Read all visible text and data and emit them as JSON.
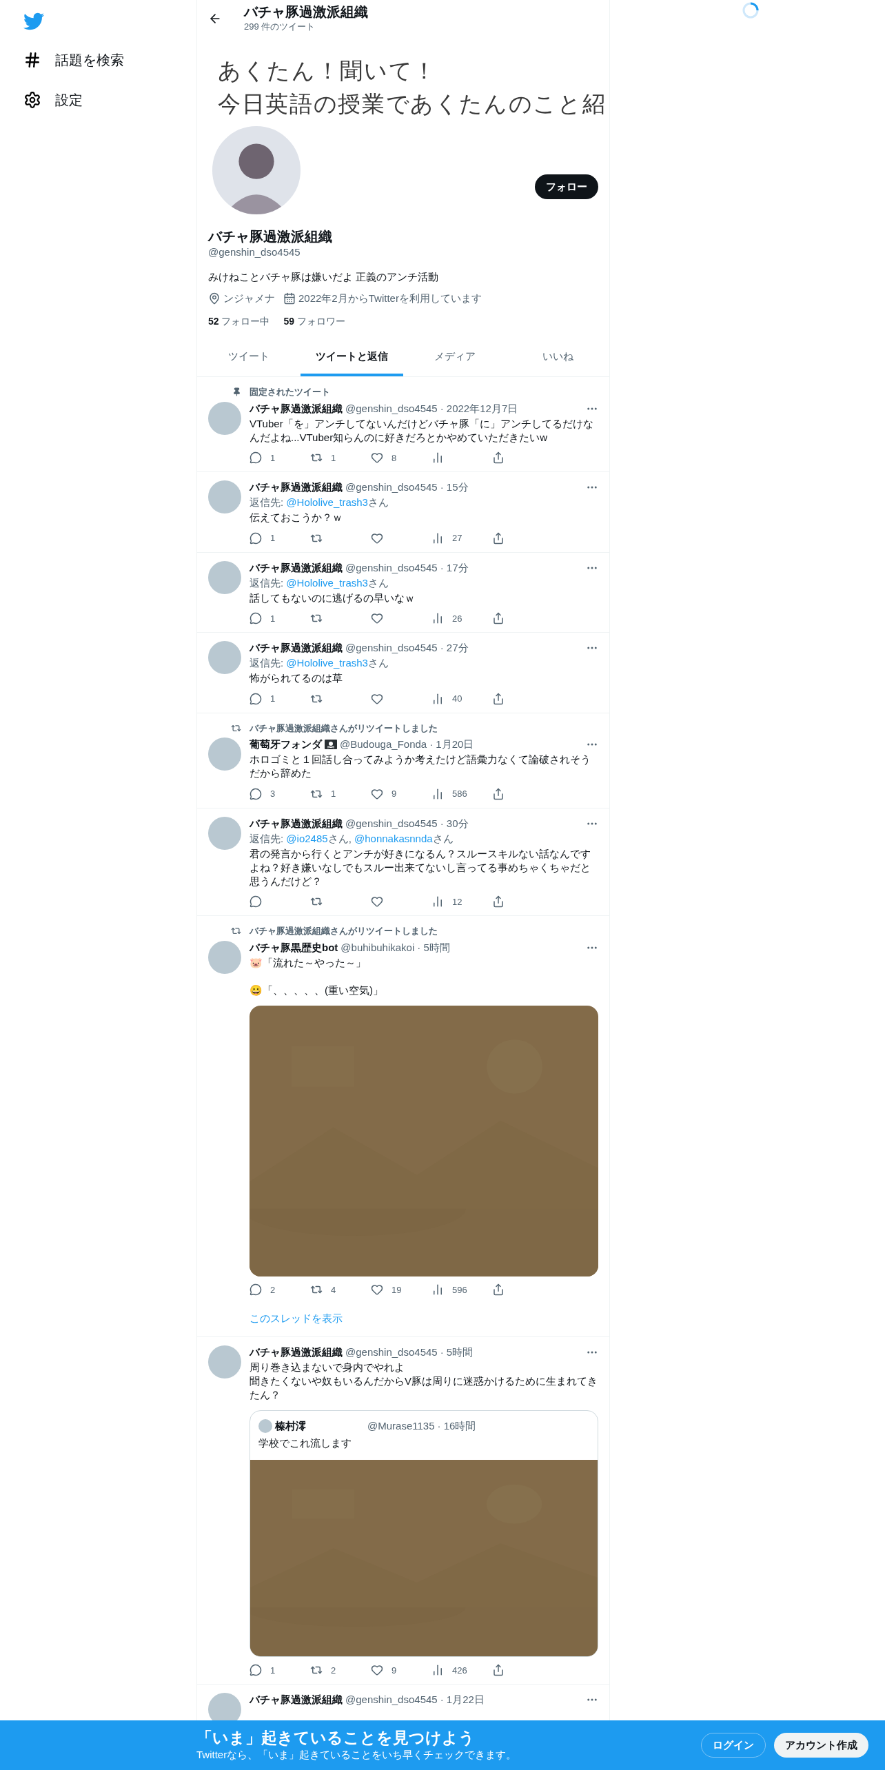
{
  "sidebar": {
    "items": [
      {
        "kind": "hash",
        "label": "話題を検索"
      },
      {
        "kind": "settings",
        "label": "設定"
      }
    ]
  },
  "header": {
    "title": "バチャ豚過激派組織",
    "subtitle": "299 件のツイート"
  },
  "banner": {
    "lines": [
      "あくたん！聞いて！",
      "今日英語の授業であくたんのこと紹"
    ]
  },
  "profile": {
    "follow_button": "フォロー",
    "name": "バチャ豚過激派組織",
    "handle": "@genshin_dso4545",
    "bio": "みけねことバチャ豚は嫌いだよ 正義のアンチ活動",
    "location": "ンジャメナ",
    "joined": "2022年2月からTwitterを利用しています",
    "stats": [
      {
        "count": "52",
        "label": "フォロー中"
      },
      {
        "count": "59",
        "label": "フォロワー"
      }
    ]
  },
  "tabs": [
    {
      "label": "ツイート",
      "selected": false
    },
    {
      "label": "ツイートと返信",
      "selected": true
    },
    {
      "label": "メディア",
      "selected": false
    },
    {
      "label": "いいね",
      "selected": false
    }
  ],
  "tweets": [
    {
      "context": {
        "kind": "pinned",
        "text": "固定されたツイート"
      },
      "name": "バチャ豚過激派組織",
      "handle": "@genshin_dso4545",
      "time": "· 2022年12月7日",
      "body": [
        [
          "VTuber「を」アンチしてないんだけどバチャ豚「に」アンチしてるだけなんだよね...VTuber知らんのに好きだろとかやめていただきたいw"
        ]
      ],
      "counts": {
        "reply": "1",
        "retweet": "1",
        "like": "8"
      }
    },
    {
      "name": "バチャ豚過激派組織",
      "handle": "@genshin_dso4545",
      "time": "· 15分",
      "reply_to": {
        "label": "返信先: ",
        "mentions": [
          {
            "handle": "@Hololive_trash3",
            "suffix": "さん"
          }
        ]
      },
      "body": [
        [
          "伝えておこうか？ｗ"
        ]
      ],
      "counts": {
        "reply": "1",
        "views": "27"
      }
    },
    {
      "name": "バチャ豚過激派組織",
      "handle": "@genshin_dso4545",
      "time": "· 17分",
      "reply_to": {
        "label": "返信先: ",
        "mentions": [
          {
            "handle": "@Hololive_trash3",
            "suffix": "さん"
          }
        ]
      },
      "body": [
        [
          "話してもないのに逃げるの早いなｗ"
        ]
      ],
      "counts": {
        "reply": "1",
        "views": "26"
      }
    },
    {
      "name": "バチャ豚過激派組織",
      "handle": "@genshin_dso4545",
      "time": "· 27分",
      "reply_to": {
        "label": "返信先: ",
        "mentions": [
          {
            "handle": "@Hololive_trash3",
            "suffix": "さん"
          }
        ]
      },
      "body": [
        [
          "怖がられてるのは草"
        ]
      ],
      "counts": {
        "reply": "1",
        "views": "40"
      }
    },
    {
      "context": {
        "kind": "retweet",
        "text": "バチャ豚過激派組織さんがリツイートしました"
      },
      "name": "葡萄牙フォンダ",
      "name_badge": {
        "kind": "pirate-flag"
      },
      "handle": "@Budouga_Fonda",
      "time": "· 1月20日",
      "body": [
        [
          "ホロゴミと１回話し合ってみようか考えたけど語彙力なくて論破されそうだから辞めた"
        ]
      ],
      "counts": {
        "reply": "3",
        "retweet": "1",
        "like": "9",
        "views": "586"
      }
    },
    {
      "name": "バチャ豚過激派組織",
      "handle": "@genshin_dso4545",
      "time": "· 30分",
      "reply_to": {
        "label": "返信先: ",
        "mentions": [
          {
            "handle": "@io2485",
            "suffix": "さん, "
          },
          {
            "handle": "@honnakasnnda",
            "suffix": "さん"
          }
        ]
      },
      "body": [
        [
          "君の発言から行くとアンチが好きになるん？スルースキルない話なんですよね？好き嫌いなしでもスルー出来てないし言ってる事めちゃくちゃだと思うんだけど？"
        ]
      ],
      "counts": {
        "views": "12"
      }
    },
    {
      "context": {
        "kind": "retweet",
        "text": "バチャ豚過激派組織さんがリツイートしました"
      },
      "name": "バチャ豚黒歴史bot",
      "handle": "@buhibuhikakoi",
      "time": "· 5時間",
      "body": [
        [
          "🐷「流れた～やった～」"
        ],
        [
          "😀「、、、、、(重い空気)」"
        ]
      ],
      "media": {
        "kind": "picture"
      },
      "counts": {
        "reply": "2",
        "retweet": "4",
        "like": "19",
        "views": "596"
      },
      "thread_link": "このスレッドを表示"
    },
    {
      "name": "バチャ豚過激派組織",
      "handle": "@genshin_dso4545",
      "time": "· 5時間",
      "body": [
        [
          "周り巻き込まないで身内でやれよ",
          "聞きたくないや奴もいるんだからV豚は周りに迷惑かけるために生まれてきたん？"
        ]
      ],
      "quote": {
        "name": "榛村澪",
        "handle": "@Murase1135",
        "time": "· 16時間",
        "body": "学校でこれ流します",
        "media": {
          "kind": "picture"
        }
      },
      "counts": {
        "reply": "1",
        "retweet": "2",
        "like": "9",
        "views": "426"
      }
    },
    {
      "name": "バチャ豚過激派組織",
      "handle": "@genshin_dso4545",
      "time": "· 1月22日"
    }
  ],
  "signup_bar": {
    "title": "「いま」起きていることを見つけよう",
    "subtitle": "Twitterなら、「いま」起きていることをいち早くチェックできます。",
    "buttons": [
      {
        "kind": "outline",
        "label": "ログイン"
      },
      {
        "kind": "filled",
        "label": "アカウント作成"
      }
    ]
  }
}
